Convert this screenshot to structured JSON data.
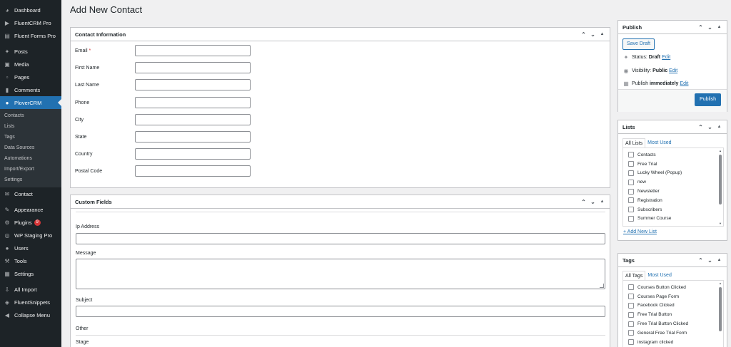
{
  "sidebar": {
    "items_top": [
      {
        "label": "Dashboard",
        "icon": "dashboard-icon"
      },
      {
        "label": "FluentCRM Pro",
        "icon": "fluentcrm-icon"
      },
      {
        "label": "Fluent Forms Pro",
        "icon": "forms-icon"
      }
    ],
    "items_mid": [
      {
        "label": "Posts",
        "icon": "pin-icon"
      },
      {
        "label": "Media",
        "icon": "media-icon"
      },
      {
        "label": "Pages",
        "icon": "pages-icon"
      },
      {
        "label": "Comments",
        "icon": "comments-icon"
      }
    ],
    "active": {
      "label": "PloverCRM",
      "icon": "user-icon"
    },
    "submenu": [
      "Contacts",
      "Lists",
      "Tags",
      "Data Sources",
      "Automations",
      "Import/Export",
      "Settings"
    ],
    "items_bottom": [
      {
        "label": "Contact",
        "icon": "mail-icon"
      },
      {
        "label": "Appearance",
        "icon": "brush-icon"
      },
      {
        "label": "Plugins",
        "icon": "plugin-icon",
        "badge": "9"
      },
      {
        "label": "WP Staging Pro",
        "icon": "staging-icon"
      },
      {
        "label": "Users",
        "icon": "users-icon"
      },
      {
        "label": "Tools",
        "icon": "wrench-icon"
      },
      {
        "label": "Settings",
        "icon": "settings-icon"
      },
      {
        "label": "All Import",
        "icon": "import-icon"
      },
      {
        "label": "FluentSnippets",
        "icon": "snippets-icon"
      },
      {
        "label": "Collapse Menu",
        "icon": "collapse-icon"
      }
    ]
  },
  "page": {
    "title": "Add New Contact"
  },
  "contact_info": {
    "title": "Contact Information",
    "fields": [
      {
        "label": "Email",
        "required": "*"
      },
      {
        "label": "First Name"
      },
      {
        "label": "Last Name"
      },
      {
        "label": "Phone"
      },
      {
        "label": "City"
      },
      {
        "label": "State"
      },
      {
        "label": "Country"
      },
      {
        "label": "Postal Code"
      }
    ]
  },
  "custom_fields": {
    "title": "Custom Fields",
    "ip_label": "Ip Address",
    "message_label": "Message",
    "subject_label": "Subject",
    "other_label": "Other",
    "stage_label": "Stage"
  },
  "publish": {
    "title": "Publish",
    "save_draft": "Save Draft",
    "status_label": "Status:",
    "status_value": "Draft",
    "visibility_label": "Visibility:",
    "visibility_value": "Public",
    "publish_label": "Publish",
    "publish_value": "immediately",
    "edit": "Edit",
    "publish_button": "Publish"
  },
  "lists": {
    "title": "Lists",
    "tab_all": "All Lists",
    "tab_most": "Most Used",
    "items": [
      "Contacts",
      "Free Trial",
      "Lucky Wheel (Popup)",
      "new",
      "Newsletter",
      "Registration",
      "Subscribers",
      "Summer Course"
    ],
    "add_new": "+ Add New List"
  },
  "tags": {
    "title": "Tags",
    "tab_all": "All Tags",
    "tab_most": "Most Used",
    "items": [
      "Courses Button Clicked",
      "Courses Page Form",
      "Facebook Clicked",
      "Free Trial Button",
      "Free Trial Button Clicked",
      "General Free Trial Form",
      "instagram clicked"
    ]
  },
  "colors": {
    "accent": "#2271b1",
    "sidebar": "#1d2327",
    "badge": "#d63638"
  }
}
